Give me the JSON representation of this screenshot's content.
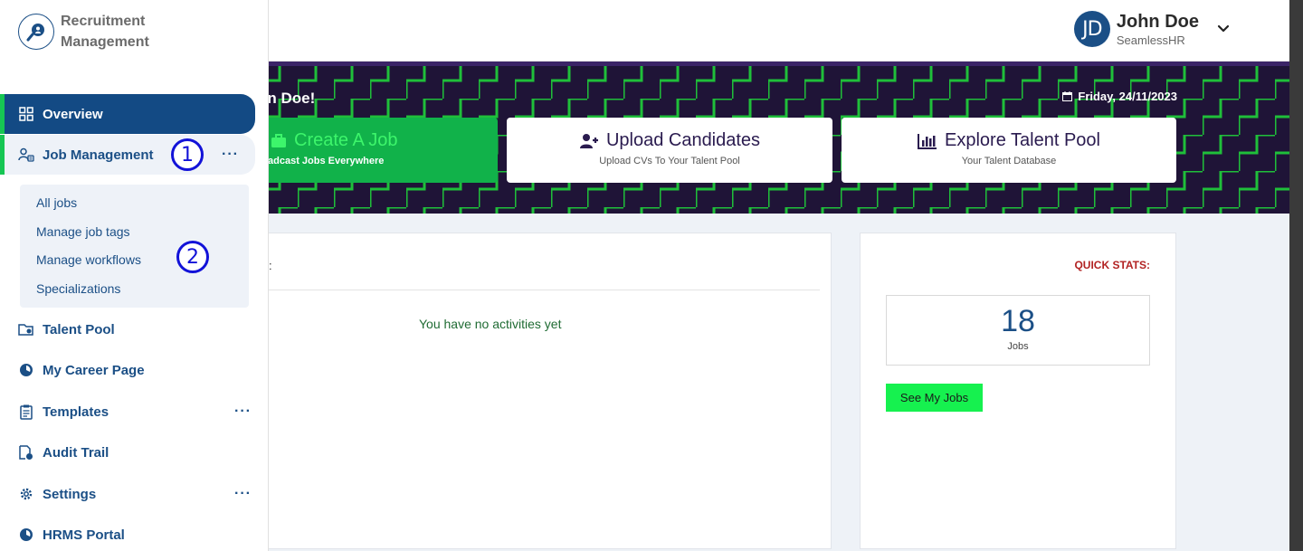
{
  "app": {
    "title_line1": "Recruitment",
    "title_line2": "Management"
  },
  "user": {
    "initials": "JD",
    "name": "John Doe",
    "org": "SeamlessHR"
  },
  "banner": {
    "welcome": "hn Doe!",
    "date": "Friday, 24/11/2023",
    "cards": {
      "create": {
        "title": "Create A Job",
        "subtitle": "roadcast Jobs Everywhere"
      },
      "upload": {
        "title": "Upload Candidates",
        "subtitle": "Upload CVs To Your Talent Pool"
      },
      "explore": {
        "title": "Explore Talent Pool",
        "subtitle": "Your Talent Database"
      }
    }
  },
  "activities": {
    "heading_fragment": ":",
    "empty": "You have no activities yet"
  },
  "stats": {
    "label": "QUICK STATS:",
    "count": "18",
    "unit": "Jobs",
    "button": "See My Jobs"
  },
  "sidebar": {
    "items": [
      {
        "label": "Overview"
      },
      {
        "label": "Job Management"
      },
      {
        "label": "Talent Pool"
      },
      {
        "label": "My Career Page"
      },
      {
        "label": "Templates"
      },
      {
        "label": "Audit Trail"
      },
      {
        "label": "Settings"
      },
      {
        "label": "HRMS Portal"
      }
    ],
    "submenu": [
      "All jobs",
      "Manage job tags",
      "Manage workflows",
      "Specializations"
    ],
    "more": "···"
  },
  "annotations": {
    "one": "1",
    "two": "2"
  },
  "colors": {
    "primary": "#1b4f86",
    "accent_green": "#16c653",
    "banner_bg": "#1f1437",
    "pattern": "#1fbf3a"
  }
}
